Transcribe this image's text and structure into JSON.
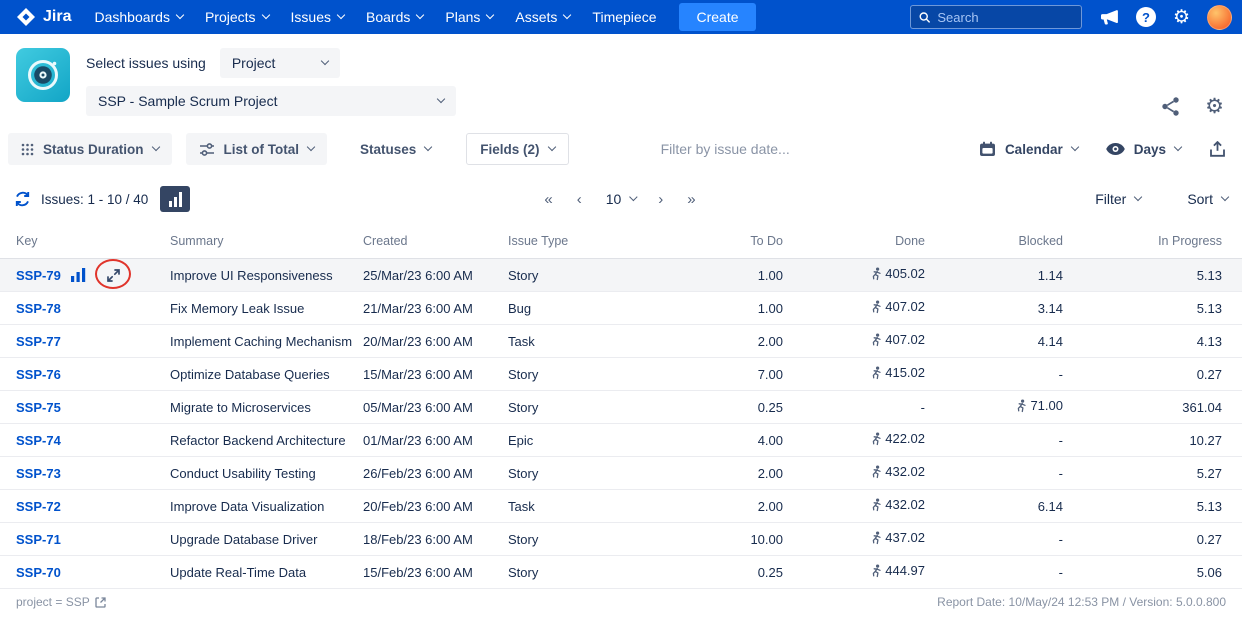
{
  "nav": {
    "logo_text": "Jira",
    "items": [
      {
        "label": "Dashboards",
        "chevron": true
      },
      {
        "label": "Projects",
        "chevron": true
      },
      {
        "label": "Issues",
        "chevron": true
      },
      {
        "label": "Boards",
        "chevron": true
      },
      {
        "label": "Plans",
        "chevron": true
      },
      {
        "label": "Assets",
        "chevron": true
      },
      {
        "label": "Timepiece",
        "chevron": false
      }
    ],
    "create_label": "Create",
    "search_placeholder": "Search"
  },
  "icons": {
    "settings_glyph": "⚙",
    "help_glyph": "?",
    "first_page": "«",
    "prev_page": "‹",
    "next_page": "›",
    "last_page": "»"
  },
  "header": {
    "select_label": "Select issues using",
    "mode_value": "Project",
    "project_value": "SSP - Sample Scrum Project"
  },
  "toolbar": {
    "status_duration_label": "Status Duration",
    "list_of_total_label": "List of Total",
    "statuses_label": "Statuses",
    "fields_label": "Fields (2)",
    "date_filter_placeholder": "Filter by issue date...",
    "calendar_label": "Calendar",
    "days_label": "Days"
  },
  "issues_bar": {
    "count_label": "Issues: 1 - 10 / 40",
    "page_size": "10",
    "filter_label": "Filter",
    "sort_label": "Sort"
  },
  "table": {
    "columns": [
      "Key",
      "Summary",
      "Created",
      "Issue Type",
      "To Do",
      "Done",
      "Blocked",
      "In Progress"
    ],
    "rows": [
      {
        "key": "SSP-79",
        "summary": "Improve UI Responsiveness",
        "created": "25/Mar/23 6:00 AM",
        "type": "Story",
        "todo": "1.00",
        "done": "405.02",
        "done_icon": true,
        "blocked": "1.14",
        "blocked_icon": false,
        "in_progress": "5.13",
        "highlighted": true
      },
      {
        "key": "SSP-78",
        "summary": "Fix Memory Leak Issue",
        "created": "21/Mar/23 6:00 AM",
        "type": "Bug",
        "todo": "1.00",
        "done": "407.02",
        "done_icon": true,
        "blocked": "3.14",
        "blocked_icon": false,
        "in_progress": "5.13",
        "highlighted": false
      },
      {
        "key": "SSP-77",
        "summary": "Implement Caching Mechanism",
        "created": "20/Mar/23 6:00 AM",
        "type": "Task",
        "todo": "2.00",
        "done": "407.02",
        "done_icon": true,
        "blocked": "4.14",
        "blocked_icon": false,
        "in_progress": "4.13",
        "highlighted": false
      },
      {
        "key": "SSP-76",
        "summary": "Optimize Database Queries",
        "created": "15/Mar/23 6:00 AM",
        "type": "Story",
        "todo": "7.00",
        "done": "415.02",
        "done_icon": true,
        "blocked": "-",
        "blocked_icon": false,
        "in_progress": "0.27",
        "highlighted": false
      },
      {
        "key": "SSP-75",
        "summary": "Migrate to Microservices",
        "created": "05/Mar/23 6:00 AM",
        "type": "Story",
        "todo": "0.25",
        "done": "-",
        "done_icon": false,
        "blocked": "71.00",
        "blocked_icon": true,
        "in_progress": "361.04",
        "highlighted": false
      },
      {
        "key": "SSP-74",
        "summary": "Refactor Backend Architecture",
        "created": "01/Mar/23 6:00 AM",
        "type": "Epic",
        "todo": "4.00",
        "done": "422.02",
        "done_icon": true,
        "blocked": "-",
        "blocked_icon": false,
        "in_progress": "10.27",
        "highlighted": false
      },
      {
        "key": "SSP-73",
        "summary": "Conduct Usability Testing",
        "created": "26/Feb/23 6:00 AM",
        "type": "Story",
        "todo": "2.00",
        "done": "432.02",
        "done_icon": true,
        "blocked": "-",
        "blocked_icon": false,
        "in_progress": "5.27",
        "highlighted": false
      },
      {
        "key": "SSP-72",
        "summary": "Improve Data Visualization",
        "created": "20/Feb/23 6:00 AM",
        "type": "Task",
        "todo": "2.00",
        "done": "432.02",
        "done_icon": true,
        "blocked": "6.14",
        "blocked_icon": false,
        "in_progress": "5.13",
        "highlighted": false
      },
      {
        "key": "SSP-71",
        "summary": "Upgrade Database Driver",
        "created": "18/Feb/23 6:00 AM",
        "type": "Story",
        "todo": "10.00",
        "done": "437.02",
        "done_icon": true,
        "blocked": "-",
        "blocked_icon": false,
        "in_progress": "0.27",
        "highlighted": false
      },
      {
        "key": "SSP-70",
        "summary": "Update Real-Time Data",
        "created": "15/Feb/23 6:00 AM",
        "type": "Story",
        "todo": "0.25",
        "done": "444.97",
        "done_icon": true,
        "blocked": "-",
        "blocked_icon": false,
        "in_progress": "5.06",
        "highlighted": false
      }
    ]
  },
  "footer": {
    "left_text": "project = SSP",
    "right_text": "Report Date: 10/May/24 12:53 PM / Version: 5.0.0.800"
  },
  "colors": {
    "nav_bg": "#0052CC",
    "create_bg": "#2684FF",
    "accent": "#0052CC",
    "annotation_red": "#E0342B",
    "app_icon_teal": "#12A5C6"
  }
}
